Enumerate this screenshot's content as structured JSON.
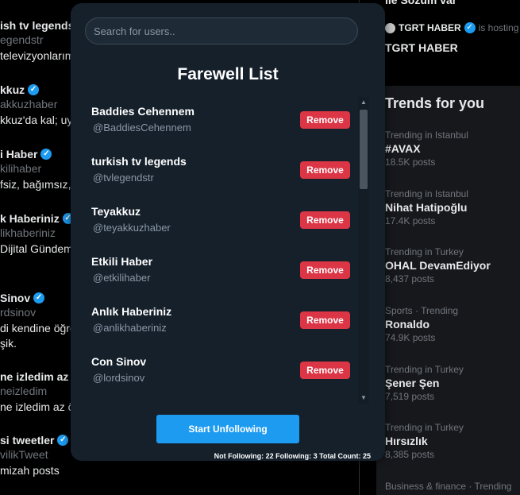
{
  "background_left": {
    "items": [
      {
        "name": "ish tv legends",
        "handle": "egendstr",
        "text": "televizyonlarım",
        "verified": false
      },
      {
        "name": "kkuz",
        "handle": "akkuzhaber",
        "text": "kkuz'da kal; uy",
        "verified": true
      },
      {
        "name": "i Haber",
        "handle": "kilihaber",
        "text": "fsiz, bağımsız, l",
        "verified": true
      },
      {
        "name": "k Haberiniz",
        "handle": "likhaberiniz",
        "text": "Dijital Gündemi.",
        "verified": true
      },
      {
        "name": "Sinov",
        "handle": "rdsinov",
        "text": "di kendine öğre",
        "text2": "şik.",
        "verified": true
      },
      {
        "name": "ne izledim az ö",
        "handle": "neizledim",
        "text": "ne izledim az ö",
        "verified": false
      },
      {
        "name": "si tweetler",
        "handle": "vilikTweet",
        "text": " mizah posts",
        "verified": true
      }
    ]
  },
  "background_right": {
    "top_text": "ile Sozum var",
    "host_line": "TGRT HABER",
    "host_suffix": "is hosting",
    "host_title": "TGRT HABER",
    "trends_title": "Trends for you",
    "trends": [
      {
        "meta": "Trending in Istanbul",
        "name": "#AVAX",
        "count": "18.5K posts"
      },
      {
        "meta": "Trending in Istanbul",
        "name": "Nihat Hatipoğlu",
        "count": "17.4K posts"
      },
      {
        "meta": "Trending in Turkey",
        "name": "OHAL DevamEdiyor",
        "count": "8,437 posts"
      },
      {
        "meta": "Sports · Trending",
        "name": "Ronaldo",
        "count": "74.9K posts"
      },
      {
        "meta": "Trending in Turkey",
        "name": "Şener Şen",
        "count": "7,519 posts"
      },
      {
        "meta": "Trending in Turkey",
        "name": "Hırsızlık",
        "count": "8,385 posts"
      },
      {
        "meta": "Business & finance · Trending",
        "name": "",
        "count": ""
      }
    ]
  },
  "modal": {
    "search_placeholder": "Search for users..",
    "title": "Farewell List",
    "remove_label": "Remove",
    "users": [
      {
        "name": "Baddies Cehennem",
        "handle": "@BaddiesCehennem"
      },
      {
        "name": "turkish tv legends",
        "handle": "@tvlegendstr"
      },
      {
        "name": "Teyakkuz",
        "handle": "@teyakkuzhaber"
      },
      {
        "name": "Etkili Haber",
        "handle": "@etkilihaber"
      },
      {
        "name": "Anlık Haberiniz",
        "handle": "@anlikhaberiniz"
      },
      {
        "name": "Con Sinov",
        "handle": "@lordsinov"
      }
    ],
    "start_button": "Start Unfollowing",
    "stats": "Not Following: 22 Following: 3 Total Count: 25"
  },
  "colors": {
    "accent": "#1d9bf0",
    "remove": "#dc3545",
    "modal_bg": "#15202b"
  }
}
